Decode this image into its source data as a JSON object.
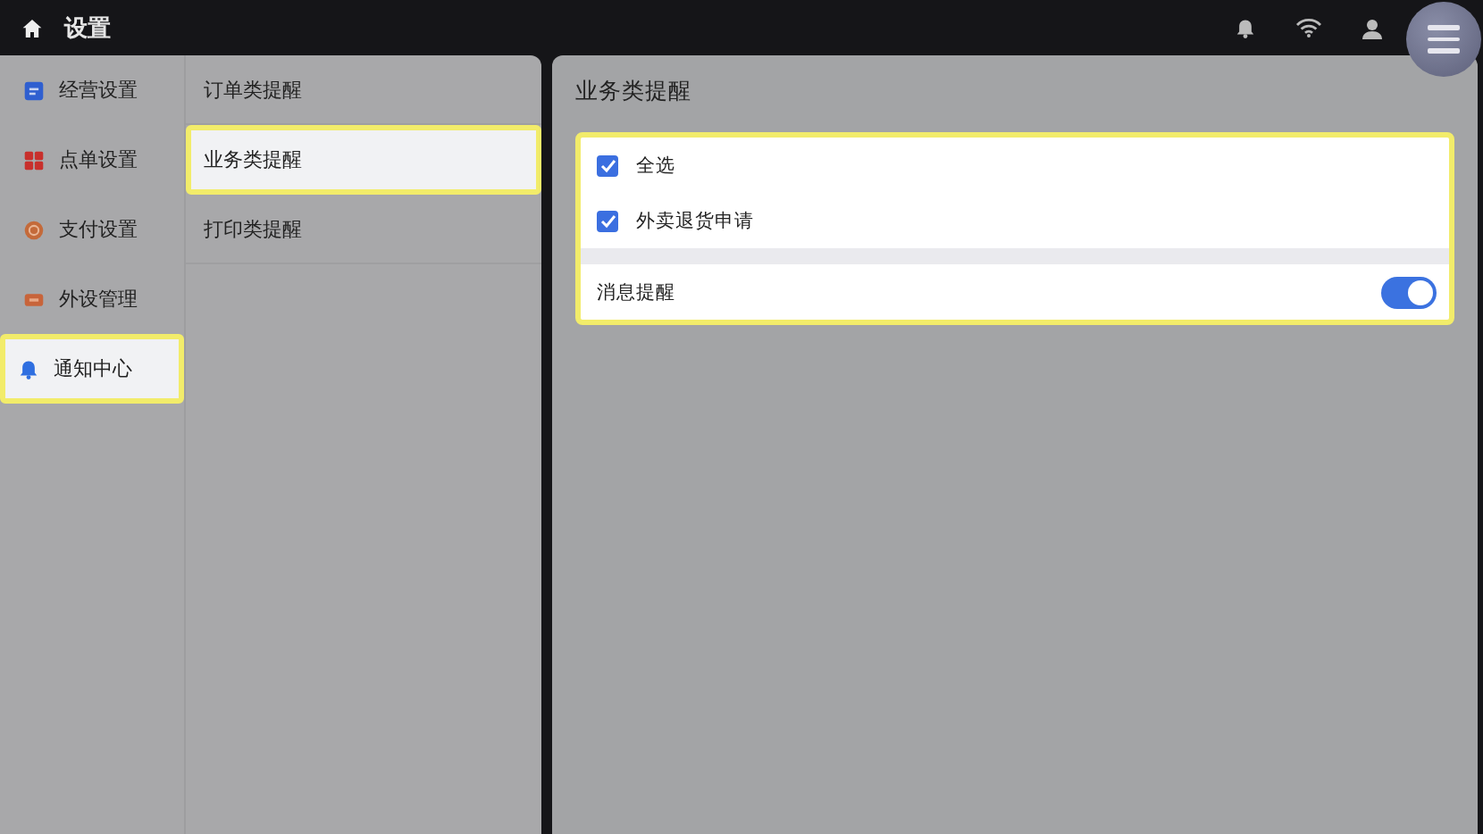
{
  "top_bar": {
    "title": "设置"
  },
  "sidebar": {
    "items": [
      {
        "label": "经营设置",
        "selected": false
      },
      {
        "label": "点单设置",
        "selected": false
      },
      {
        "label": "支付设置",
        "selected": false
      },
      {
        "label": "外设管理",
        "selected": false
      },
      {
        "label": "通知中心",
        "selected": true
      }
    ]
  },
  "submenu": {
    "items": [
      {
        "label": "订单类提醒",
        "selected": false
      },
      {
        "label": "业务类提醒",
        "selected": true
      },
      {
        "label": "打印类提醒",
        "selected": false
      }
    ]
  },
  "panel": {
    "title": "业务类提醒",
    "highlighted": true,
    "checkboxes": [
      {
        "label": "全选",
        "checked": true
      },
      {
        "label": "外卖退货申请",
        "checked": true
      }
    ],
    "toggle": {
      "label": "消息提醒",
      "on": true
    }
  }
}
